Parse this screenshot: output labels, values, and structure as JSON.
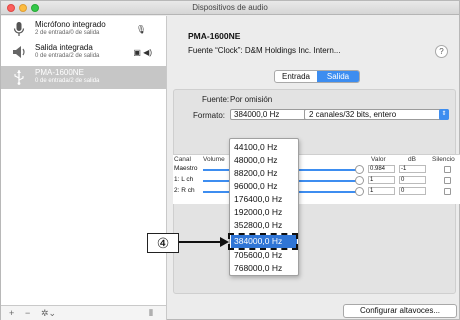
{
  "window": {
    "title": "Dispositivos de audio"
  },
  "sidebar": {
    "devices": [
      {
        "name": "Micrófono integrado",
        "sub": "2 de entrada/0 de salida",
        "icon": "microphone-icon",
        "badge": "🎙"
      },
      {
        "name": "Salida integrada",
        "sub": "0 de entrada/2 de salida",
        "icon": "speaker-icon",
        "badge": "▣ ◀)"
      },
      {
        "name": "PMA-1600NE",
        "sub": "0 de entrada/2 de salida",
        "icon": "usb-icon",
        "badge": ""
      }
    ],
    "footer": {
      "add": "+",
      "remove": "−",
      "gear": "✲⌄",
      "resize": "⦀"
    }
  },
  "detail": {
    "device_title": "PMA-1600NE",
    "clock_text": "Fuente “Clock”:  D&M Holdings Inc. Intern...",
    "help": "?",
    "tabs": [
      {
        "label": "Entrada"
      },
      {
        "label": "Salida"
      }
    ],
    "source_label": "Fuente:",
    "source_value": "Por omisión",
    "format_label": "Formato:",
    "format_value": "384000,0 Hz",
    "channels_value": "2 canales/32 bits, entero",
    "volume": {
      "headers": {
        "channel": "Canal",
        "volume": "Volume",
        "value": "Valor",
        "db": "dB",
        "mute": "Silencio"
      },
      "rows": [
        {
          "label": "Maestro",
          "value": "0.984",
          "db": "-1",
          "level": 0.984
        },
        {
          "label": "1: L ch",
          "value": "1",
          "db": "0",
          "level": 1.0
        },
        {
          "label": "2: R ch",
          "value": "1",
          "db": "0",
          "level": 1.0
        }
      ]
    },
    "configure_button": "Configurar altavoces..."
  },
  "format_menu": {
    "options": [
      "44100,0 Hz",
      "48000,0 Hz",
      "88200,0 Hz",
      "96000,0 Hz",
      "176400,0 Hz",
      "192000,0 Hz",
      "352800,0 Hz",
      "384000,0 Hz",
      "705600,0 Hz",
      "768000,0 Hz"
    ],
    "selected": "384000,0 Hz"
  },
  "annotation": {
    "step": "④"
  },
  "colors": {
    "accent": "#3d8df0",
    "selection": "#2f75d6"
  }
}
